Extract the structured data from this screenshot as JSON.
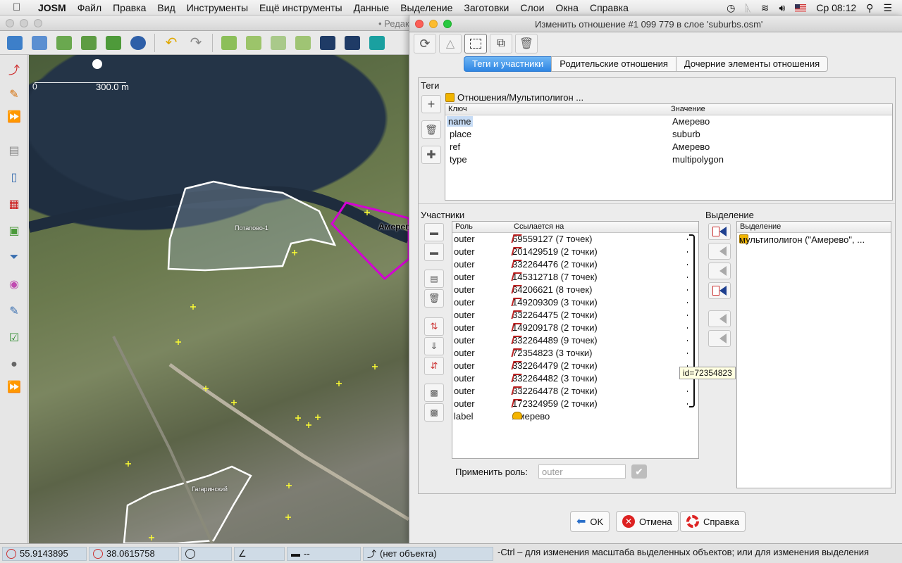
{
  "menubar": {
    "app": "JOSM",
    "items": [
      "Файл",
      "Правка",
      "Вид",
      "Инструменты",
      "Ещё инструменты",
      "Данные",
      "Выделение",
      "Заготовки",
      "Слои",
      "Окна",
      "Справка"
    ],
    "clock": "Ср 08:12"
  },
  "main_window": {
    "title_fragment": "• Редак"
  },
  "map": {
    "scale_zero": "0",
    "scale_label": "300.0 m",
    "labels": {
      "potapovo": "Потапово-1",
      "amerevo": "Амерево",
      "gagarinsky": "Гагаринский"
    }
  },
  "dialog": {
    "title": "Изменить отношение #1 099 779 в слое 'suburbs.osm'",
    "tabs": [
      "Теги и участники",
      "Родительские отношения",
      "Дочерние элементы отношения"
    ],
    "tags": {
      "section": "Теги",
      "preset": "Отношения/Мультиполигон ...",
      "col_key": "Ключ",
      "col_value": "Значение",
      "rows": [
        {
          "key": "name",
          "value": "Амерево"
        },
        {
          "key": "place",
          "value": "suburb"
        },
        {
          "key": "ref",
          "value": "Амерево"
        },
        {
          "key": "type",
          "value": "multipolygon"
        }
      ]
    },
    "members": {
      "section": "Участники",
      "col_role": "Роль",
      "col_ref": "Ссылается на",
      "rows": [
        {
          "role": "outer",
          "ref": "69559127 (7 точек)"
        },
        {
          "role": "outer",
          "ref": "201429519 (2 точки)"
        },
        {
          "role": "outer",
          "ref": "332264476 (2 точки)"
        },
        {
          "role": "outer",
          "ref": "145312718 (7 точек)"
        },
        {
          "role": "outer",
          "ref": "64206621 (8 точек)"
        },
        {
          "role": "outer",
          "ref": "149209309 (3 точки)"
        },
        {
          "role": "outer",
          "ref": "332264475 (2 точки)"
        },
        {
          "role": "outer",
          "ref": "149209178 (2 точки)"
        },
        {
          "role": "outer",
          "ref": "332264489 (9 точек)"
        },
        {
          "role": "outer",
          "ref": "72354823 (3 точки)"
        },
        {
          "role": "outer",
          "ref": "332264479 (2 точки)"
        },
        {
          "role": "outer",
          "ref": "332264482 (3 точки)"
        },
        {
          "role": "outer",
          "ref": "332264478 (2 точки)"
        },
        {
          "role": "outer",
          "ref": "172324959 (2 точки)"
        },
        {
          "role": "label",
          "ref": "Амерево"
        }
      ],
      "tooltip": "id=72354823",
      "apply_role_label": "Применить роль:",
      "apply_role_value": "outer"
    },
    "selection": {
      "section": "Выделение",
      "col": "Выделение",
      "rows": [
        "мультиполигон (\"Амерево\", ..."
      ]
    },
    "buttons": {
      "ok": "OK",
      "cancel": "Отмена",
      "help": "Справка"
    }
  },
  "statusbar": {
    "lat": "55.9143895",
    "lon": "38.0615758",
    "dist": "--",
    "object": "(нет объекта)",
    "hint": "-Ctrl – для изменения масштаба выделенных объектов; или для изменения выделения"
  }
}
